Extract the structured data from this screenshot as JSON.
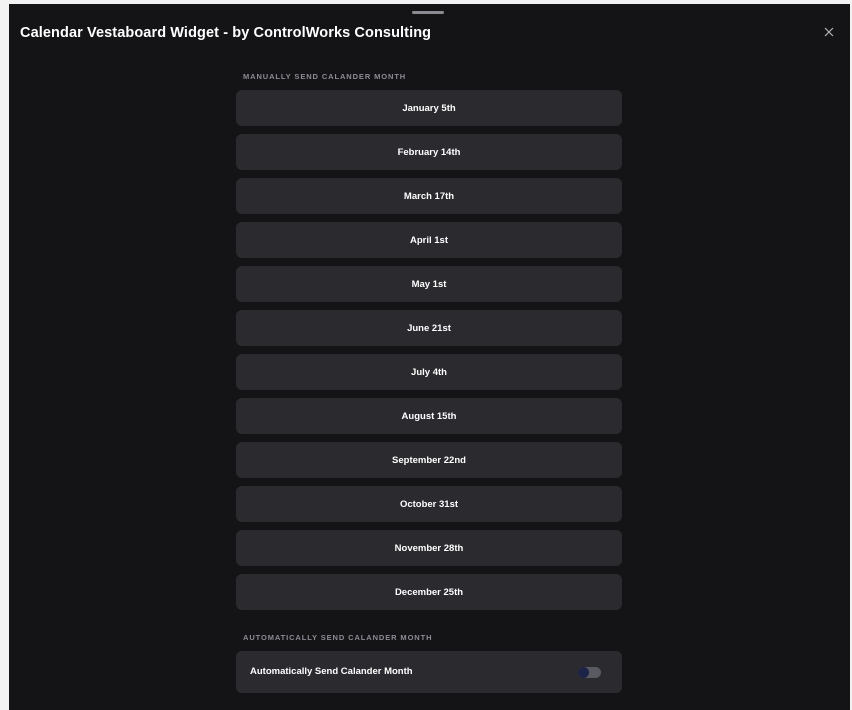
{
  "window": {
    "title": "Calendar Vestaboard Widget - by ControlWorks Consulting",
    "close_icon": "close-icon"
  },
  "manual_section": {
    "heading": "MANUALLY SEND CALANDER MONTH",
    "buttons": [
      {
        "label": "January 5th"
      },
      {
        "label": "February 14th"
      },
      {
        "label": "March 17th"
      },
      {
        "label": "April 1st"
      },
      {
        "label": "May 1st"
      },
      {
        "label": "June 21st"
      },
      {
        "label": "July 4th"
      },
      {
        "label": "August 15th"
      },
      {
        "label": "September 22nd"
      },
      {
        "label": "October 31st"
      },
      {
        "label": "November 28th"
      },
      {
        "label": "December 25th"
      }
    ]
  },
  "auto_section": {
    "heading": "AUTOMATICALLY SEND CALANDER MONTH",
    "toggle_label": "Automatically Send Calander Month",
    "toggle_on": false
  },
  "colors": {
    "background": "#141316",
    "button": "#2b2a2f",
    "text": "#ffffff",
    "label": "#8c8c94",
    "toggle_track": "#5a5a62",
    "toggle_knob": "#1c2347"
  }
}
